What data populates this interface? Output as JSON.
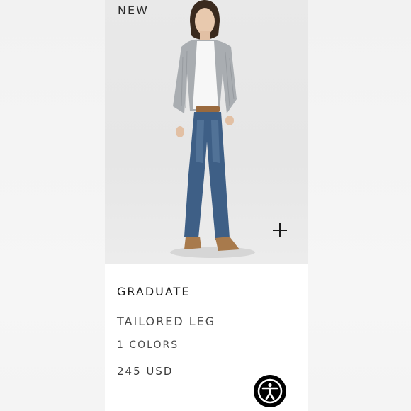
{
  "product": {
    "badge": "NEW",
    "name": "GRADUATE",
    "fit": "TAILORED LEG",
    "colors": "1 COLORS",
    "price": "245 USD"
  },
  "icons": {
    "quick_add": "plus-icon",
    "accessibility": "accessibility-icon"
  },
  "colors": {
    "badge": "#000000",
    "text": "#1b1b1b"
  }
}
